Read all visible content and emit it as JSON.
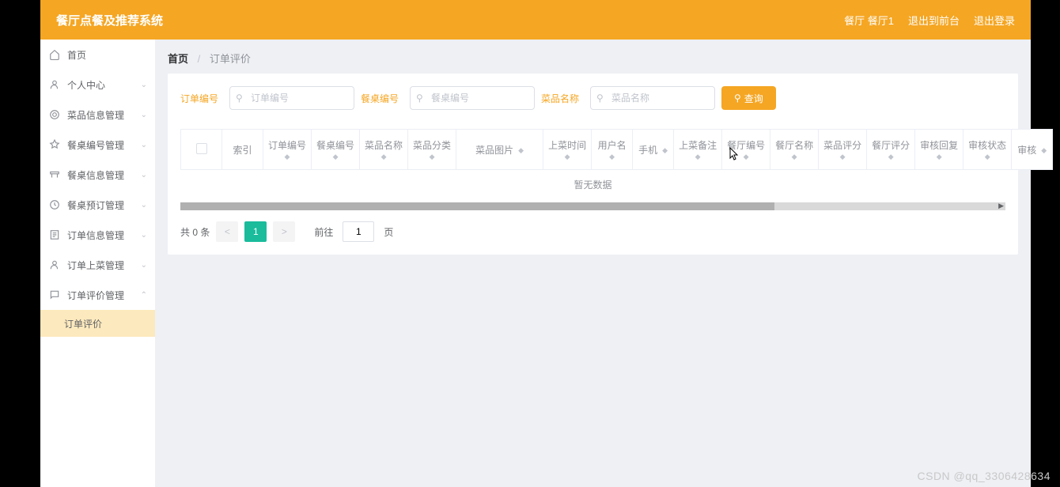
{
  "header": {
    "title": "餐厅点餐及推荐系统",
    "user_label": "餐厅 餐厅1",
    "logout_front": "退出到前台",
    "logout": "退出登录"
  },
  "sidebar": {
    "items": [
      {
        "icon": "home",
        "label": "首页"
      },
      {
        "icon": "user",
        "label": "个人中心"
      },
      {
        "icon": "dish",
        "label": "菜品信息管理"
      },
      {
        "icon": "table",
        "label": "餐桌编号管理"
      },
      {
        "icon": "desk",
        "label": "餐桌信息管理"
      },
      {
        "icon": "clock",
        "label": "餐桌预订管理"
      },
      {
        "icon": "order",
        "label": "订单信息管理"
      },
      {
        "icon": "serve",
        "label": "订单上菜管理"
      },
      {
        "icon": "review",
        "label": "订单评价管理"
      }
    ],
    "sub_label": "订单评价"
  },
  "breadcrumb": {
    "home": "首页",
    "current": "订单评价"
  },
  "search": {
    "f1_label": "订单编号",
    "f1_ph": "订单编号",
    "f2_label": "餐桌编号",
    "f2_ph": "餐桌编号",
    "f3_label": "菜品名称",
    "f3_ph": "菜品名称",
    "btn": "查询"
  },
  "table": {
    "cols": [
      "索引",
      "订单编号",
      "餐桌编号",
      "菜品名称",
      "菜品分类",
      "菜品图片",
      "上菜时间",
      "用户名",
      "手机",
      "上菜备注",
      "餐厅编号",
      "餐厅名称",
      "菜品评分",
      "餐厅评分",
      "审核回复",
      "审核状态",
      "审核"
    ],
    "no_data": "暂无数据"
  },
  "pagination": {
    "total": "共 0 条",
    "page": "1",
    "goto_prefix": "前往",
    "goto_value": "1",
    "goto_suffix": "页"
  },
  "watermark": "CSDN @qq_3306428634"
}
